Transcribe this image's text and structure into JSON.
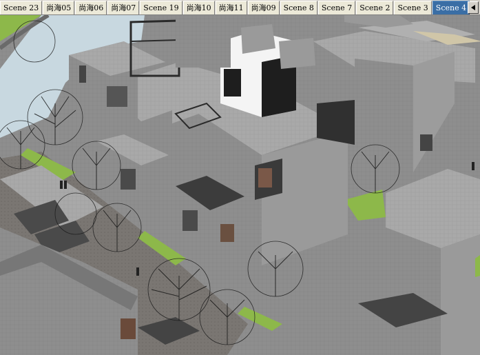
{
  "tabs": [
    {
      "label": "Scene 23",
      "active": false
    },
    {
      "label": "尚海05",
      "active": false
    },
    {
      "label": "尚海06",
      "active": false
    },
    {
      "label": "尚海07",
      "active": false
    },
    {
      "label": "Scene 19",
      "active": false
    },
    {
      "label": "尚海10",
      "active": false
    },
    {
      "label": "尚海11",
      "active": false
    },
    {
      "label": "尚海09",
      "active": false
    },
    {
      "label": "Scene 8",
      "active": false
    },
    {
      "label": "Scene 7",
      "active": false
    },
    {
      "label": "Scene 2",
      "active": false
    },
    {
      "label": "Scene 3",
      "active": false
    },
    {
      "label": "Scene 4",
      "active": true
    }
  ],
  "scroll_arrow_icon": "triangle-left-icon",
  "colors": {
    "tab_active_bg": "#3a6ea5",
    "wall_gray": "#8c8c8c",
    "roof_gray": "#b0b0b0",
    "lawn_green": "#8db84a",
    "water_blue": "#c8d8e0"
  }
}
